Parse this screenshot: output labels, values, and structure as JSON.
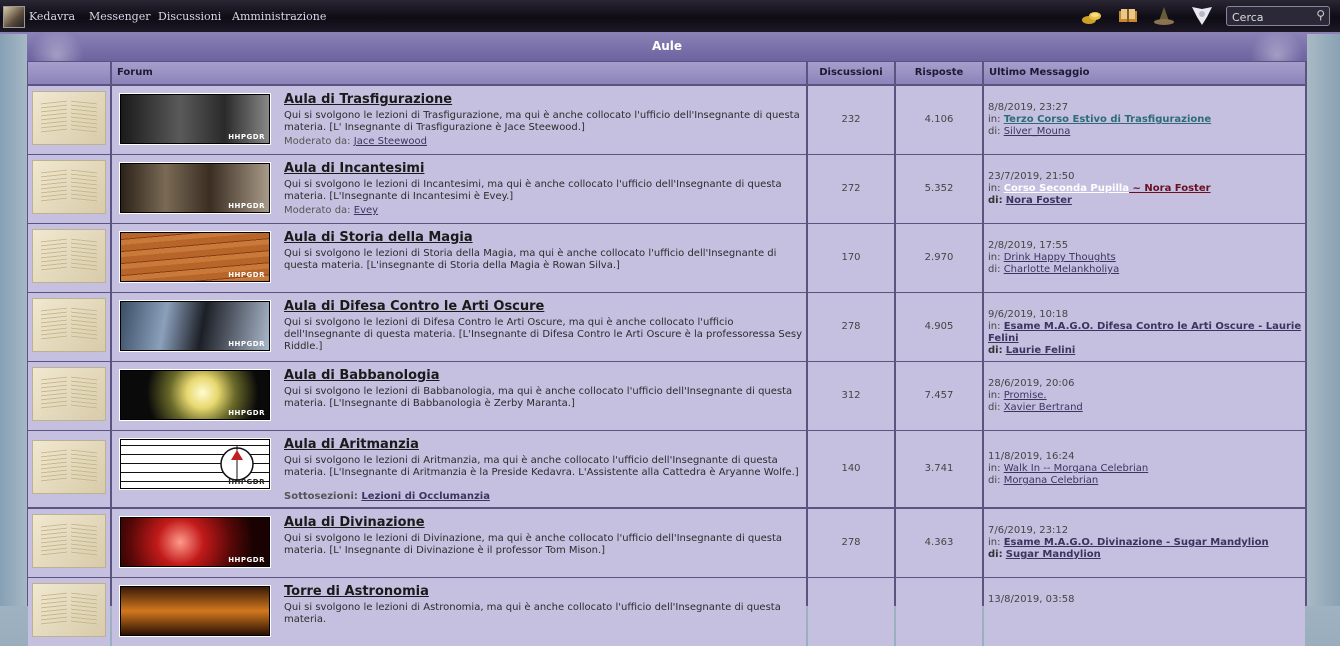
{
  "topbar": {
    "username": "Kedavra",
    "nav": [
      "Messenger",
      "Discussioni",
      "Amministrazione"
    ],
    "search_placeholder": "Cerca",
    "icons": [
      "galleon-icon",
      "book-icon",
      "hat-icon",
      "owl-icon"
    ]
  },
  "category": {
    "title": "Aule"
  },
  "columns": {
    "forum": "Forum",
    "discussioni": "Discussioni",
    "risposte": "Risposte",
    "ultimo": "Ultimo Messaggio"
  },
  "labels": {
    "moderato": "Moderato da:",
    "sottosezioni": "Sottosezioni:",
    "in": "in:",
    "di": "di:",
    "banner_tag": "HHPGDR"
  },
  "forums": [
    {
      "title": "Aula di Trasfigurazione",
      "desc": "Qui si svolgono le lezioni di Trasfigurazione, ma qui è anche collocato l'ufficio dell'Insegnante di questa materia. [L' Insegnante di Trasfigurazione è Jace Steewood.]",
      "moderator": "Jace Steewood",
      "sub": "",
      "topics": "232",
      "replies": "4.106",
      "last_date": "8/8/2019, 23:27",
      "last_in": "Terzo Corso Estivo di Trasfigurazione",
      "last_in2": "",
      "last_by": "Silver_Mouna"
    },
    {
      "title": "Aula di Incantesimi",
      "desc": "Qui si svolgono le lezioni di Incantesimi, ma qui è anche collocato l'ufficio dell'Insegnante di questa materia. [L'Insegnante di Incantesimi è Evey.]",
      "moderator": "Evey",
      "sub": "",
      "topics": "272",
      "replies": "5.352",
      "last_date": "23/7/2019, 21:50",
      "last_in": "Corso Seconda Pupilla",
      "last_in2": " ~ Nora Foster ",
      "last_by": "Nora Foster"
    },
    {
      "title": "Aula di Storia della Magia",
      "desc": "Qui si svolgono le lezioni di Storia della Magia, ma qui è anche collocato l'ufficio dell'Insegnante di questa materia. [L'insegnante di Storia della Magia è Rowan Silva.]",
      "moderator": "",
      "sub": "",
      "topics": "170",
      "replies": "2.970",
      "last_date": "2/8/2019, 17:55",
      "last_in": "Drink Happy Thoughts",
      "last_in2": "",
      "last_by": "Charlotte Melankholiya"
    },
    {
      "title": "Aula di Difesa Contro le Arti Oscure",
      "desc": "Qui si svolgono le lezioni di Difesa Contro le Arti Oscure, ma qui è anche collocato l'ufficio dell'Insegnante di questa materia. [L'Insegnante di Difesa Contro le Arti Oscure è la professoressa Sesy Riddle.]",
      "moderator": "",
      "sub": "",
      "topics": "278",
      "replies": "4.905",
      "last_date": "9/6/2019, 10:18",
      "last_in": "Esame M.A.G.O. Difesa Contro le Arti Oscure - Laurie Felini",
      "last_in2": "",
      "last_by": "Laurie Felini"
    },
    {
      "title": "Aula di Babbanologia",
      "desc": "Qui si svolgono le lezioni di Babbanologia, ma qui è anche collocato l'ufficio dell'Insegnante di questa materia. [L'Insegnante di Babbanologia è Zerby Maranta.]",
      "moderator": "",
      "sub": "",
      "topics": "312",
      "replies": "7.457",
      "last_date": "28/6/2019, 20:06",
      "last_in": "Promise.",
      "last_in2": "",
      "last_by": "Xavier Bertrand"
    },
    {
      "title": "Aula di Aritmanzia",
      "desc": "Qui si svolgono le lezioni di Aritmanzia, ma qui è anche collocato l'ufficio dell'Insegnante di questa materia. [L'Insegnante di Aritmanzia è la Preside Kedavra. L'Assistente alla Cattedra è Aryanne Wolfe.]",
      "moderator": "",
      "sub": "Lezioni di Occlumanzia",
      "topics": "140",
      "replies": "3.741",
      "last_date": "11/8/2019, 16:24",
      "last_in": "Walk In -- Morgana Celebrian",
      "last_in2": "",
      "last_by": "Morgana Celebrian"
    },
    {
      "title": "Aula di Divinazione",
      "desc": "Qui si svolgono le lezioni di Divinazione, ma qui è anche collocato l'ufficio dell'Insegnante di questa materia. [L' Insegnante di Divinazione è il professor Tom Mison.]",
      "moderator": "",
      "sub": "",
      "topics": "278",
      "replies": "4.363",
      "last_date": "7/6/2019, 23:12",
      "last_in": "Esame M.A.G.O. Divinazione - Sugar Mandylion",
      "last_in2": "",
      "last_by": "Sugar Mandylion"
    },
    {
      "title": "Torre di Astronomia",
      "desc": "Qui si svolgono le lezioni di Astronomia, ma qui è anche collocato l'ufficio dell'Insegnante di questa materia.",
      "moderator": "",
      "sub": "",
      "topics": "",
      "replies": "",
      "last_date": "13/8/2019, 03:58",
      "last_in": "",
      "last_in2": "",
      "last_by": ""
    }
  ]
}
